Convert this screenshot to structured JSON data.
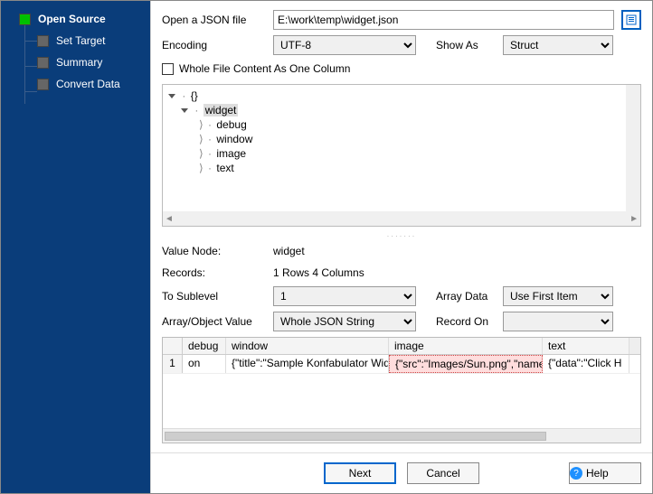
{
  "sidebar": {
    "items": [
      {
        "label": "Open Source"
      },
      {
        "label": "Set Target"
      },
      {
        "label": "Summary"
      },
      {
        "label": "Convert Data"
      }
    ]
  },
  "form": {
    "open_label": "Open a JSON file",
    "path": "E:\\work\\temp\\widget.json",
    "encoding_label": "Encoding",
    "encoding_value": "UTF-8",
    "showas_label": "Show As",
    "showas_value": "Struct",
    "whole_file_label": "Whole File Content As One Column"
  },
  "tree": {
    "root": "{}",
    "nodes": [
      {
        "label": "widget",
        "children": [
          "debug",
          "window",
          "image",
          "text"
        ]
      }
    ]
  },
  "info": {
    "value_node_label": "Value Node:",
    "value_node": "widget",
    "records_label": "Records:",
    "records_value": "1 Rows    4 Columns",
    "sublevel_label": "To Sublevel",
    "sublevel_value": "1",
    "arraydata_label": "Array Data",
    "arraydata_value": "Use First Item",
    "arrobj_label": "Array/Object Value",
    "arrobj_value": "Whole JSON String",
    "recordon_label": "Record On",
    "recordon_value": ""
  },
  "table": {
    "headers": [
      "debug",
      "window",
      "image",
      "text"
    ],
    "rows": [
      {
        "num": "1",
        "debug": "on",
        "window": "{\"title\":\"Sample Konfabulator Widget\"",
        "image": "{\"src\":\"Images/Sun.png\",\"name\":",
        "text": "{\"data\":\"Click H"
      }
    ]
  },
  "buttons": {
    "next": "Next",
    "cancel": "Cancel",
    "help": "Help"
  }
}
